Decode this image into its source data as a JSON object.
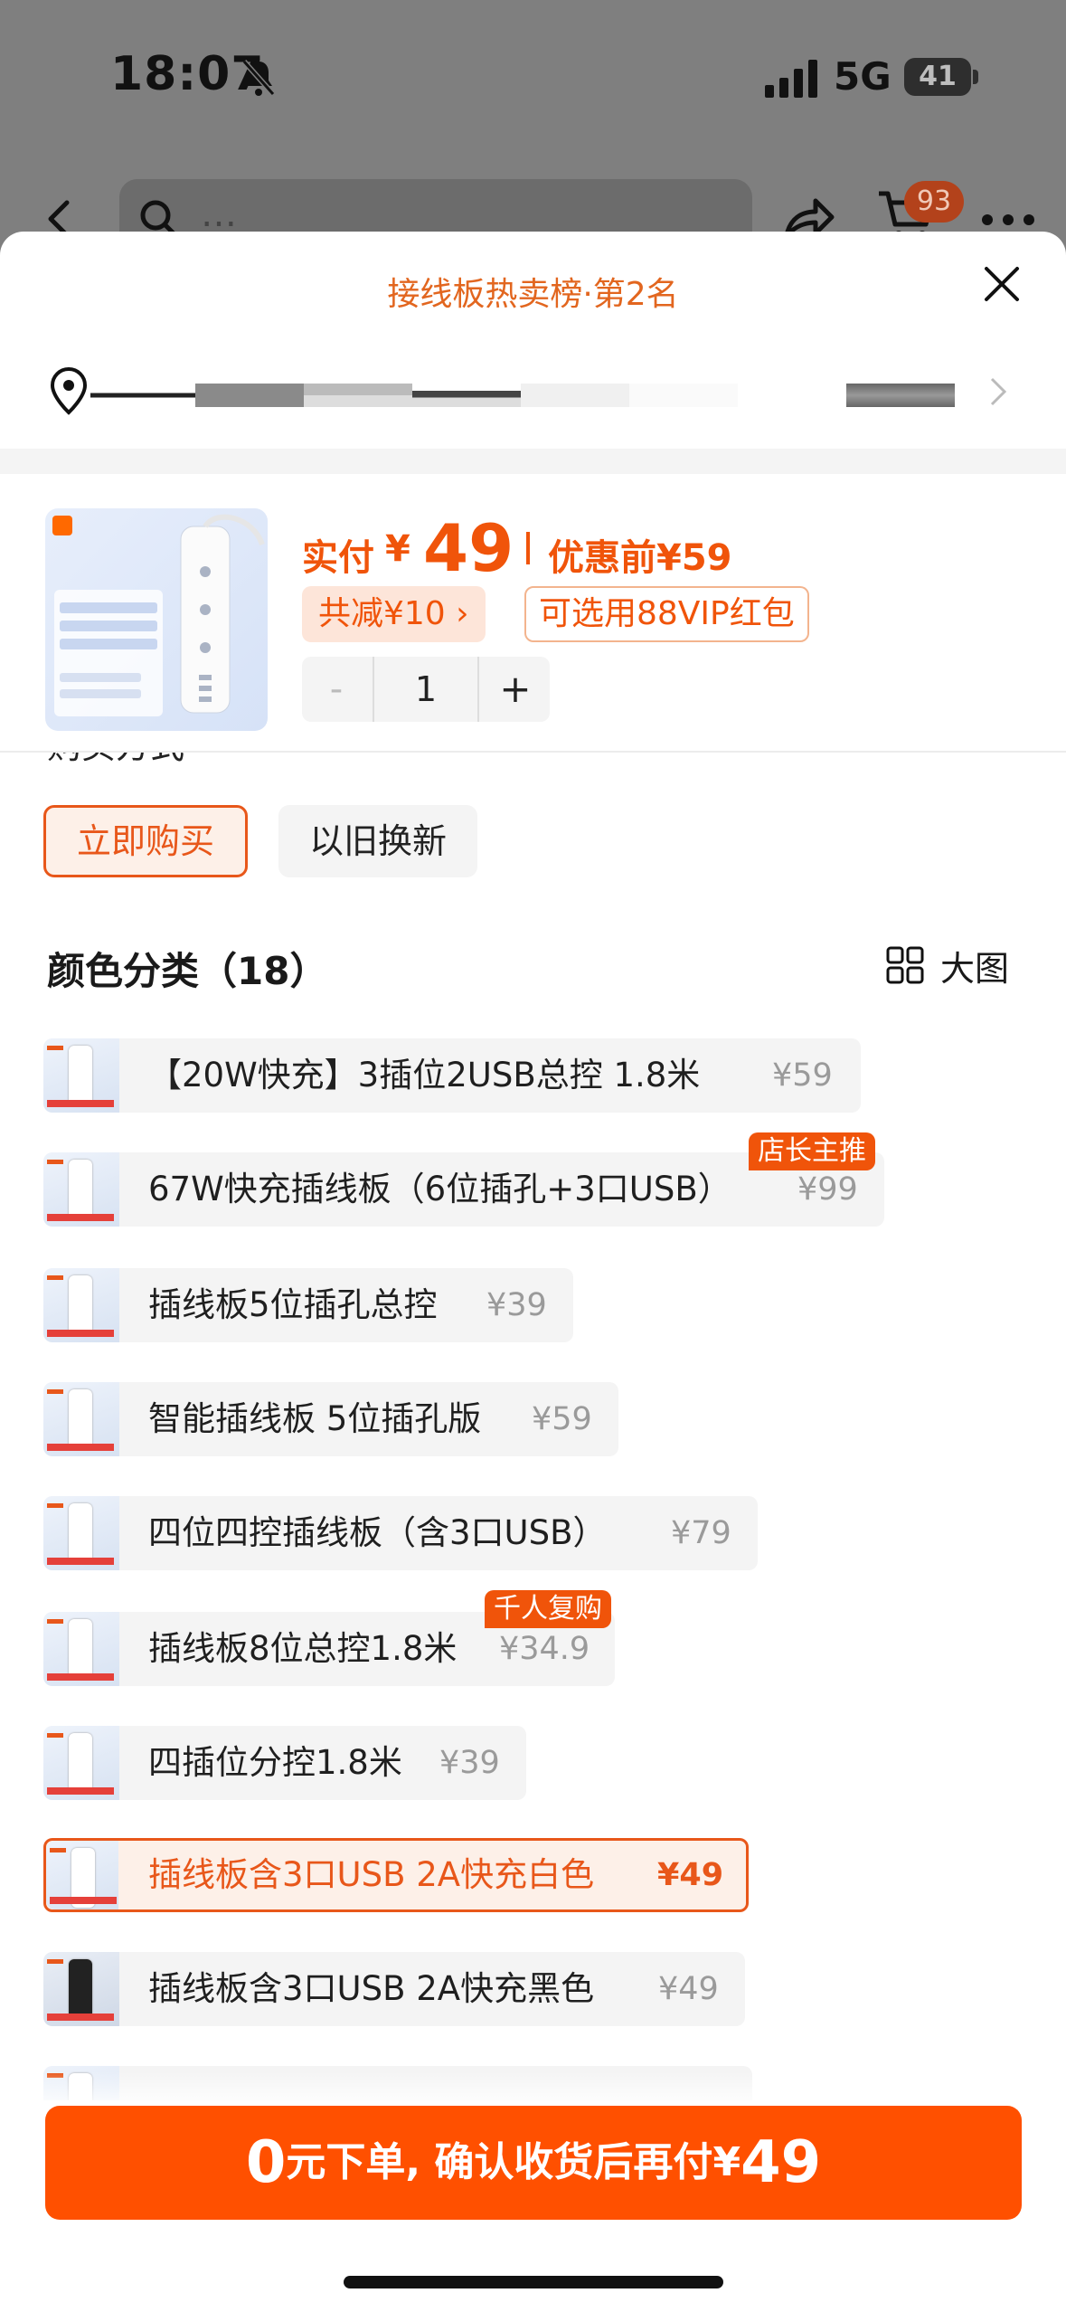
{
  "status_bar": {
    "time": "18:07",
    "network": "5G",
    "battery": "41"
  },
  "background_nav": {
    "search_text": "…",
    "cart_badge": "93"
  },
  "sheet": {
    "title": "接线板热卖榜·第2名"
  },
  "summary": {
    "price_label": "实付",
    "currency": "¥",
    "price": "49",
    "before_label": "优惠前¥59",
    "discount": "共减¥10 ›",
    "vip": "可选用88VIP红包",
    "stepper": {
      "minus": "-",
      "qty": "1",
      "plus": "+"
    }
  },
  "purchase": {
    "title_partial": "购买方式",
    "buy_now": "立即购买",
    "trade_in": "以旧换新"
  },
  "colors": {
    "title": "颜色分类（18）",
    "big_view": "大图",
    "items": [
      {
        "name": "【20W快充】3插位2USB总控 1.8米",
        "price": "¥59"
      },
      {
        "name": "67W快充插线板（6位插孔+3口USB）",
        "price": "¥99",
        "tag": "店长主推"
      },
      {
        "name": "插线板5位插孔总控",
        "price": "¥39"
      },
      {
        "name": "智能插线板 5位插孔版",
        "price": "¥59"
      },
      {
        "name": "四位四控插线板（含3口USB）",
        "price": "¥79"
      },
      {
        "name": "插线板8位总控1.8米",
        "price": "¥34.9",
        "tag": "千人复购"
      },
      {
        "name": "四插位分控1.8米",
        "price": "¥39"
      },
      {
        "name": "插线板含3口USB 2A快充白色",
        "price": "¥49",
        "selected": true
      },
      {
        "name": "插线板含3口USB 2A快充黑色",
        "price": "¥49"
      }
    ]
  },
  "cta": {
    "zero": "0",
    "text": "元下单, 确认收货后再付",
    "yen": "¥",
    "amount": "49"
  },
  "accent_color": "#ff5000"
}
